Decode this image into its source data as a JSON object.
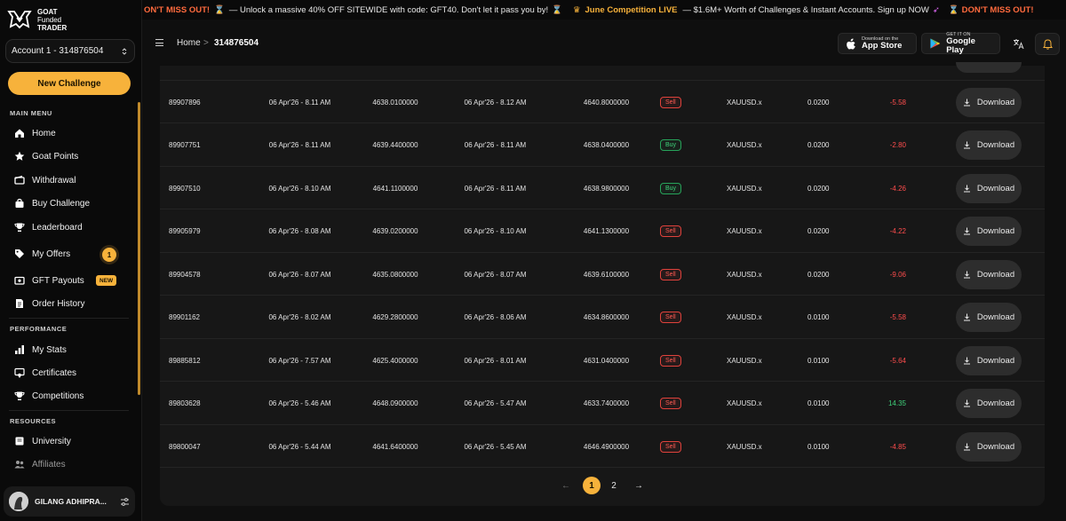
{
  "brand": {
    "line1": "GOAT",
    "line2": "Funded",
    "line3": "TRADER"
  },
  "account": {
    "selected": "Account 1 - 314876504"
  },
  "new_challenge_label": "New Challenge",
  "sidebar": {
    "main_menu_label": "MAIN MENU",
    "main_items": [
      {
        "label": "Home",
        "icon": "home-icon"
      },
      {
        "label": "Goat Points",
        "icon": "star-icon"
      },
      {
        "label": "Withdrawal",
        "icon": "wallet-icon"
      },
      {
        "label": "Buy Challenge",
        "icon": "bag-icon"
      },
      {
        "label": "Leaderboard",
        "icon": "trophy-icon"
      },
      {
        "label": "My Offers",
        "icon": "tag-icon",
        "badge": "1"
      },
      {
        "label": "GFT Payouts",
        "icon": "payout-icon",
        "badge": "NEW"
      },
      {
        "label": "Order History",
        "icon": "document-icon"
      }
    ],
    "performance_label": "PERFORMANCE",
    "performance_items": [
      {
        "label": "My Stats",
        "icon": "bar-chart-icon"
      },
      {
        "label": "Certificates",
        "icon": "certificate-icon"
      },
      {
        "label": "Competitions",
        "icon": "trophy-icon"
      }
    ],
    "resources_label": "RESOURCES",
    "resources_items": [
      {
        "label": "University",
        "icon": "book-icon"
      },
      {
        "label": "Affiliates",
        "icon": "users-icon"
      }
    ]
  },
  "user": {
    "name": "GILANG ADHIPRA..."
  },
  "banner": {
    "seg1": "ON'T MISS OUT!",
    "seg2": "—  Unlock a massive 40% OFF SITEWIDE with code: GFT40. Don't let it pass you by!",
    "seg3": "June Competition LIVE",
    "seg4": "—  $1.6M+ Worth of Challenges & Instant Accounts. Sign up NOW",
    "seg5": "DON'T MISS OUT!"
  },
  "breadcrumb": {
    "home": "Home",
    "separator": ">",
    "current": "314876504"
  },
  "stores": {
    "apple_small": "Download on the",
    "apple_big": "App Store",
    "google_small": "GET IT ON",
    "google_big": "Google Play"
  },
  "download_label": "Download",
  "trades": [
    {
      "id": "89907896",
      "open_time": "06 Apr'26 - 8.11 AM",
      "open_price": "4638.0100000",
      "close_time": "06 Apr'26 - 8.12 AM",
      "close_price": "4640.8000000",
      "type": "Sell",
      "symbol": "XAUUSD.x",
      "volume": "0.0200",
      "pnl": "-5.58"
    },
    {
      "id": "89907751",
      "open_time": "06 Apr'26 - 8.11 AM",
      "open_price": "4639.4400000",
      "close_time": "06 Apr'26 - 8.11 AM",
      "close_price": "4638.0400000",
      "type": "Buy",
      "symbol": "XAUUSD.x",
      "volume": "0.0200",
      "pnl": "-2.80"
    },
    {
      "id": "89907510",
      "open_time": "06 Apr'26 - 8.10 AM",
      "open_price": "4641.1100000",
      "close_time": "06 Apr'26 - 8.11 AM",
      "close_price": "4638.9800000",
      "type": "Buy",
      "symbol": "XAUUSD.x",
      "volume": "0.0200",
      "pnl": "-4.26"
    },
    {
      "id": "89905979",
      "open_time": "06 Apr'26 - 8.08 AM",
      "open_price": "4639.0200000",
      "close_time": "06 Apr'26 - 8.10 AM",
      "close_price": "4641.1300000",
      "type": "Sell",
      "symbol": "XAUUSD.x",
      "volume": "0.0200",
      "pnl": "-4.22"
    },
    {
      "id": "89904578",
      "open_time": "06 Apr'26 - 8.07 AM",
      "open_price": "4635.0800000",
      "close_time": "06 Apr'26 - 8.07 AM",
      "close_price": "4639.6100000",
      "type": "Sell",
      "symbol": "XAUUSD.x",
      "volume": "0.0200",
      "pnl": "-9.06"
    },
    {
      "id": "89901162",
      "open_time": "06 Apr'26 - 8.02 AM",
      "open_price": "4629.2800000",
      "close_time": "06 Apr'26 - 8.06 AM",
      "close_price": "4634.8600000",
      "type": "Sell",
      "symbol": "XAUUSD.x",
      "volume": "0.0100",
      "pnl": "-5.58"
    },
    {
      "id": "89885812",
      "open_time": "06 Apr'26 - 7.57 AM",
      "open_price": "4625.4000000",
      "close_time": "06 Apr'26 - 8.01 AM",
      "close_price": "4631.0400000",
      "type": "Sell",
      "symbol": "XAUUSD.x",
      "volume": "0.0100",
      "pnl": "-5.64"
    },
    {
      "id": "89803628",
      "open_time": "06 Apr'26 - 5.46 AM",
      "open_price": "4648.0900000",
      "close_time": "06 Apr'26 - 5.47 AM",
      "close_price": "4633.7400000",
      "type": "Sell",
      "symbol": "XAUUSD.x",
      "volume": "0.0100",
      "pnl": "14.35"
    },
    {
      "id": "89800047",
      "open_time": "06 Apr'26 - 5.44 AM",
      "open_price": "4641.6400000",
      "close_time": "06 Apr'26 - 5.45 AM",
      "close_price": "4646.4900000",
      "type": "Sell",
      "symbol": "XAUUSD.x",
      "volume": "0.0100",
      "pnl": "-4.85"
    }
  ],
  "pagination": {
    "prev": "←",
    "pages": [
      "1",
      "2"
    ],
    "current": "1",
    "next": "→"
  },
  "colors": {
    "accent": "#f7b23b",
    "sell": "#ff5a52",
    "buy": "#3fd17a",
    "loss": "#ff4d4d",
    "profit": "#3fd17a"
  }
}
